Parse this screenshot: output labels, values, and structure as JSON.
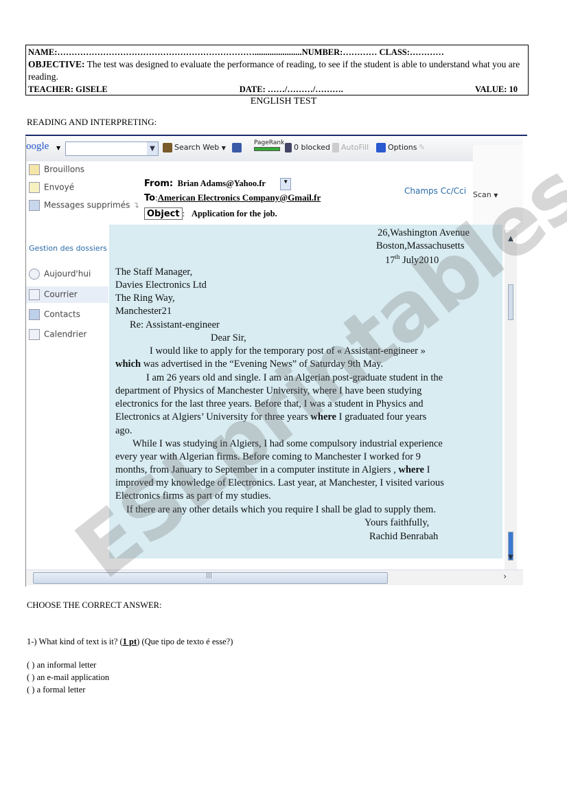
{
  "header": {
    "name_line": "NAME:……………………………………………………………......................NUMBER:………… CLASS:…………",
    "objective_label": "OBJECTIVE:",
    "objective_text": " The test was designed to evaluate the performance of reading, to see if the student is able to understand what you are reading.",
    "teacher": "TEACHER:  GISELE",
    "date": "DATE: ……/………/……….",
    "value": "VALUE:  10"
  },
  "title": "ENGLISH TEST",
  "section": "READING AND INTERPRETING:",
  "browser": {
    "google_logo": "oogle",
    "toolbar": {
      "search_web": "Search Web",
      "pagerank": "PageRank",
      "blocked": "0 blocked",
      "autofill": "AutoFill",
      "options": "Options"
    },
    "sidebar": {
      "items_top": [
        "Brouillons",
        "Envoyé",
        "Messages supprimés"
      ],
      "gestion": "Gestion des dossiers",
      "items_bottom": [
        "Aujourd'hui",
        "Courrier",
        "Contacts",
        "Calendrier"
      ]
    },
    "mail": {
      "from_label": "From:",
      "from_value": "Brian Adams@Yahoo.fr",
      "to_label": "To",
      "to_value": "American Electronics Company@Gmail.fr",
      "object_label": "Object",
      "object_value": "Application for the job.",
      "cc": "Champs Cc/Cci",
      "scan": "Scan"
    },
    "letter": {
      "addr1": "26,Washington Avenue",
      "addr2": "Boston,Massachusetts",
      "date_day": "17",
      "date_sup": "th",
      "date_rest": " July2010",
      "recipient": [
        "The Staff Manager,",
        "Davies Electronics Ltd",
        "The Ring Way,",
        "Manchester21"
      ],
      "re": "Re: Assistant-engineer",
      "salutation": "Dear Sir,",
      "p1_l1": "I would like to apply for the temporary post of « Assistant-engineer »",
      "p1_l2_bold": "which",
      "p1_l2": " was advertised in the “Evening News” of Saturday 9th May.",
      "p2_l1": "I am 26 years old and single. I am an Algerian post-graduate student in the",
      "p2_l2": "department of Physics of Manchester University, where I have been studying",
      "p2_l3": "electronics for the last three years. Before that, I was a student in Physics and",
      "p2_l4a": "Electronics at Algiers’ University for three years ",
      "p2_l4_bold": "where",
      "p2_l4b": " I graduated four years",
      "p2_l5": "ago.",
      "p3_l1": "While I was studying in Algiers, I had some compulsory industrial experience",
      "p3_l2": "every year with Algerian firms. Before coming to Manchester I worked for 9",
      "p3_l3a": "months, from January to September in a computer institute in Algiers , ",
      "p3_l3_bold": "where",
      "p3_l3b": " I",
      "p3_l4": "improved my knowledge of Electronics. Last year, at Manchester, I visited various",
      "p3_l5": "Electronics firms as part of my studies.",
      "p4": "If there are any other details which you require I shall be glad to supply them.",
      "closing": "Yours faithfully,",
      "signature": "Rachid Benrabah"
    }
  },
  "questions": {
    "instruction": "CHOOSE THE CORRECT  ANSWER:",
    "q1_text": "1-)  What kind  of  text is it?   (",
    "q1_points": "1 pt",
    "q1_after": ")     (Que tipo  de texto é esse?)",
    "options": [
      "(    ) an informal  letter",
      "(    )  an e-mail application",
      "(    )  a formal letter"
    ]
  },
  "watermark": "ESLprintables.com",
  "colors": {
    "letter_bg": "#d8ecf2",
    "rule": "#1a2a6c",
    "link": "#2a6aa8"
  }
}
